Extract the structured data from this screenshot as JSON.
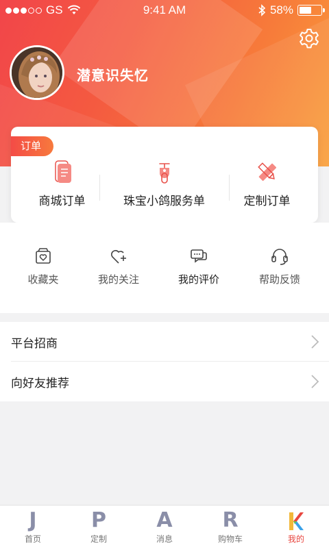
{
  "status_bar": {
    "carrier": "GS",
    "time": "9:41 AM",
    "battery": "58%",
    "battery_level": 0.58
  },
  "profile": {
    "username": "潜意识失忆"
  },
  "orders": {
    "tag": "订单",
    "items": [
      {
        "label": "商城订单",
        "icon": "document-icon"
      },
      {
        "label": "珠宝小鸽服务单",
        "icon": "scooter-icon"
      },
      {
        "label": "定制订单",
        "icon": "pencil-ruler-icon"
      }
    ]
  },
  "quick_links": [
    {
      "label": "收藏夹",
      "icon": "heart-folder-icon"
    },
    {
      "label": "我的关注",
      "icon": "heart-plus-icon"
    },
    {
      "label": "我的评价",
      "icon": "chat-bubbles-icon"
    },
    {
      "label": "帮助反馈",
      "icon": "headset-icon"
    }
  ],
  "menu": [
    {
      "label": "平台招商"
    },
    {
      "label": "向好友推荐"
    }
  ],
  "tabbar": [
    {
      "glyph": "J",
      "label": "首页"
    },
    {
      "glyph": "P",
      "label": "定制"
    },
    {
      "glyph": "A",
      "label": "消息"
    },
    {
      "glyph": "R",
      "label": "购物车"
    },
    {
      "glyph": "K",
      "label": "我的",
      "active": true
    }
  ],
  "colors": {
    "accent": "#e8463f",
    "header_start": "#f2454a",
    "header_end": "#f9a03b"
  }
}
